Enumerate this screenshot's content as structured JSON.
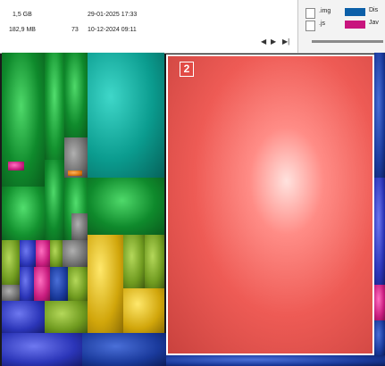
{
  "file_list": {
    "rows": [
      {
        "size": "1,5 GB",
        "count": "",
        "date": "29-01-2025 17:33"
      },
      {
        "size": "182,9 MB",
        "count": "73",
        "date": "10-12-2024 09:11"
      }
    ],
    "nav": {
      "prev": "◀",
      "next": "▶",
      "end": "▶|"
    }
  },
  "legend": {
    "items": [
      {
        "ext": ".img",
        "color": "#0b5fa8",
        "desc": "Dis"
      },
      {
        "ext": ".js",
        "color": "#c8157e",
        "desc": "Jav"
      }
    ]
  },
  "treemap": {
    "selected": {
      "marker": "2",
      "color": "#ee5b55"
    }
  }
}
